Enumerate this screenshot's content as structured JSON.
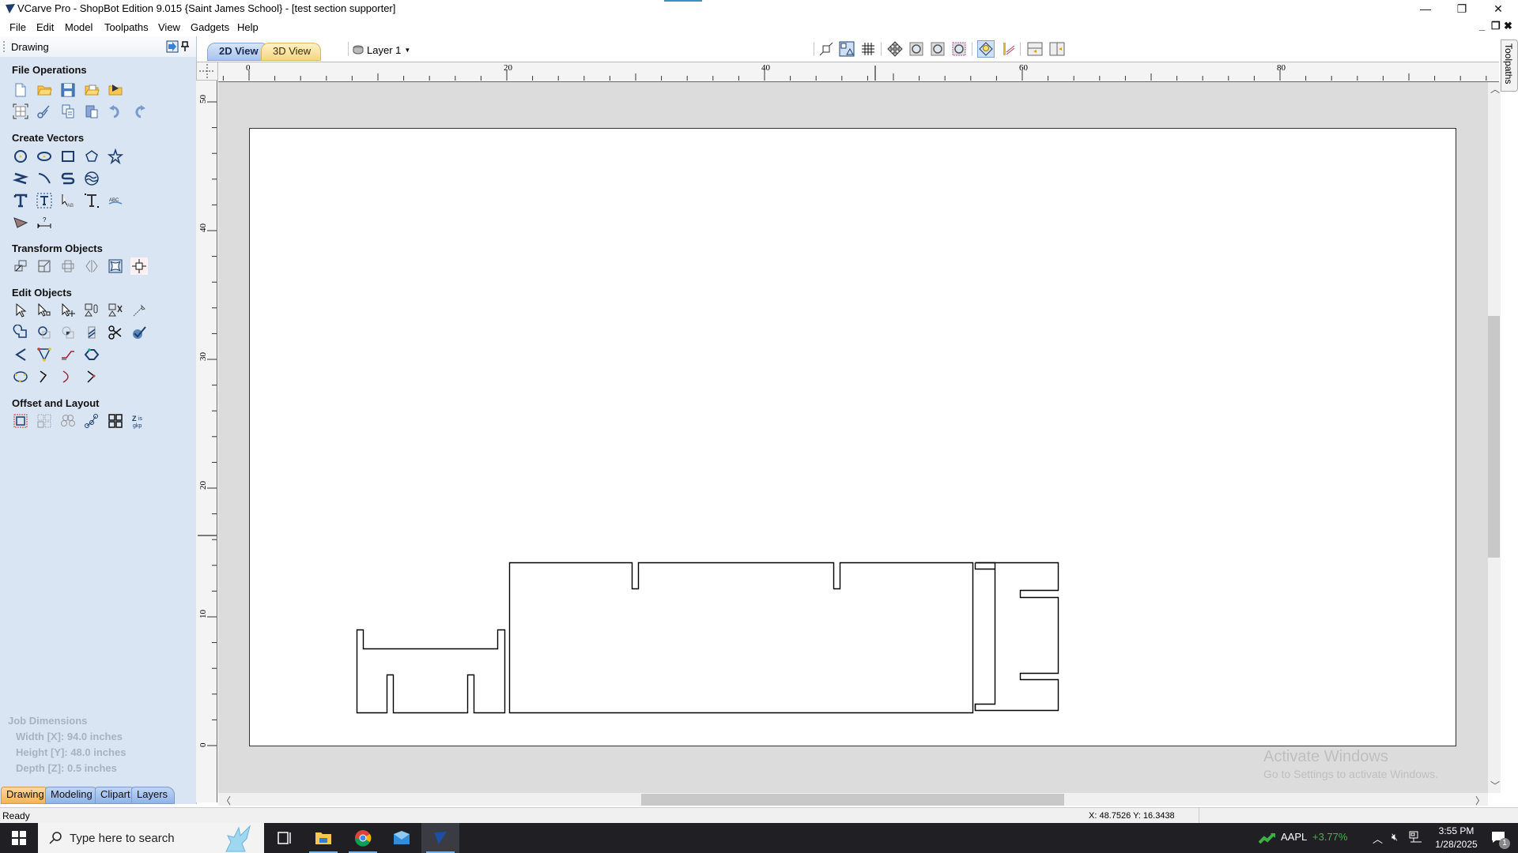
{
  "window": {
    "title": "VCarve Pro - ShopBot Edition 9.015 {Saint James School} - [test section supporter]",
    "min_glyph": "—",
    "restore_glyph": "❐",
    "close_glyph": "✕",
    "doc_min": "_",
    "doc_restore": "❐",
    "doc_close": "✖"
  },
  "menu": [
    "File",
    "Edit",
    "Model",
    "Toolpaths",
    "View",
    "Gadgets",
    "Help"
  ],
  "left_panel": {
    "title": "Drawing",
    "sections": {
      "file_operations": "File Operations",
      "create_vectors": "Create Vectors",
      "transform_objects": "Transform Objects",
      "edit_objects": "Edit Objects",
      "offset_layout": "Offset and Layout"
    },
    "tools": {
      "file_operations": [
        "new-file",
        "open-file",
        "save-file",
        "import-vectors",
        "import-component",
        "job-setup",
        "cut",
        "copy",
        "paste",
        "undo",
        "redo"
      ],
      "create_vectors": [
        "draw-circle",
        "draw-ellipse",
        "draw-rectangle",
        "draw-polygon",
        "draw-star",
        "draw-polyline",
        "draw-curve",
        "draw-arc",
        "draw-wave",
        "create-text",
        "auto-layout-text",
        "text-on-curve",
        "adjust-spacing",
        "text-arc",
        "dimension-tool",
        "measure-tool"
      ],
      "transform_objects": [
        "move",
        "scale",
        "align",
        "mirror",
        "distort",
        "set-size"
      ],
      "edit_objects": [
        "select",
        "node-edit",
        "interactive-transform",
        "group",
        "ungroup",
        "measure",
        "weld",
        "subtract",
        "intersect",
        "trim",
        "scissors",
        "join-curves",
        "smooth-curves",
        "node-insert",
        "line-curve",
        "close-vectors",
        "fit-curve",
        "curve-fillet",
        "curve-chamfer",
        "extend"
      ],
      "offset_layout": [
        "offset",
        "array-copy",
        "circular-array",
        "copy-along-vectors",
        "nesting",
        "auto-layout-text"
      ]
    },
    "job_dimensions": {
      "heading": "Job Dimensions",
      "width": "Width  [X]: 94.0 inches",
      "height": "Height [Y]: 48.0 inches",
      "depth": "Depth  [Z]: 0.5 inches"
    },
    "tabs": [
      "Drawing",
      "Modeling",
      "Clipart",
      "Layers"
    ],
    "active_tab": "Drawing"
  },
  "view_tabs": [
    "2D View",
    "3D View"
  ],
  "active_view": "2D View",
  "layer_selector": "Layer 1",
  "view_toolbar": [
    "zoom-to-selection",
    "toggle-sheet",
    "grid",
    "pan",
    "zoom-in",
    "zoom-fit",
    "zoom-box",
    "render-toggle",
    "toolpath-preview",
    "split-horizontal",
    "split-vertical"
  ],
  "ruler": {
    "x_labels": [
      "0",
      "20",
      "40",
      "60",
      "80"
    ],
    "y_labels": [
      "50",
      "40",
      "30",
      "20",
      "10",
      "0"
    ]
  },
  "right_dock": {
    "label": "Toolpaths"
  },
  "watermark": {
    "line1": "Activate Windows",
    "line2": "Go to Settings to activate Windows."
  },
  "status": {
    "text": "Ready",
    "coords": "X: 48.7526 Y: 16.3438"
  },
  "taskbar": {
    "search_placeholder": "Type here to search",
    "stock": {
      "ticker": "AAPL",
      "change": "+3.77%"
    },
    "time": "3:55 PM",
    "date": "1/28/2025",
    "notification_count": "1",
    "apps": [
      "task-view",
      "file-explorer",
      "chrome",
      "mail",
      "vcarve"
    ]
  },
  "colors": {
    "panel_bg": "#d9e5f2",
    "tab_active": "#f7b256",
    "tab_inactive": "#8fb3e8",
    "stock_up": "#4caf50"
  }
}
